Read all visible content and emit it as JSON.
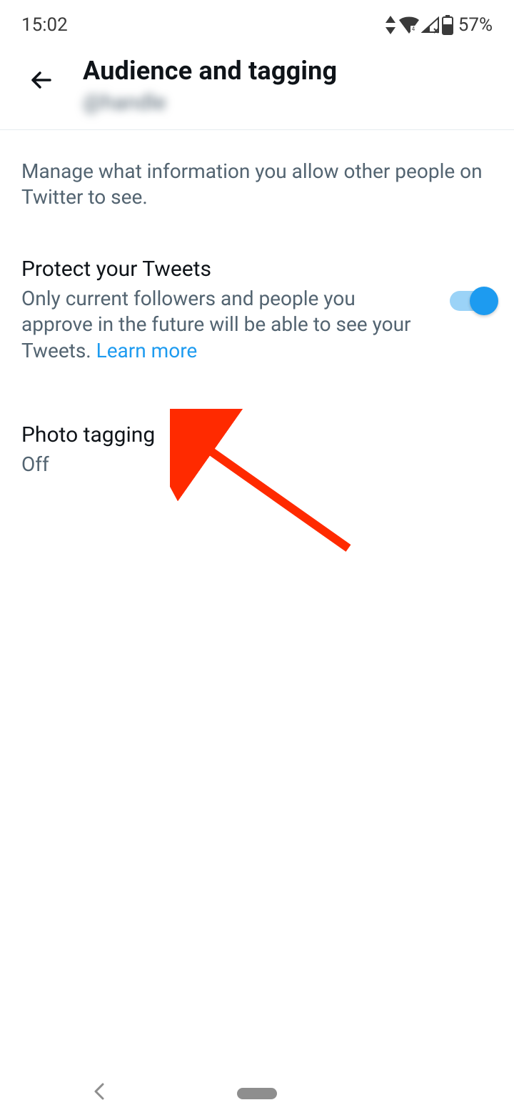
{
  "status_bar": {
    "time": "15:02",
    "battery_text": "57%"
  },
  "appbar": {
    "title": "Audience and tagging",
    "subtitle": "@handle"
  },
  "description": "Manage what information you allow other people on Twitter to see.",
  "protect": {
    "title": "Protect your Tweets",
    "desc_prefix": "Only current followers and people you approve in the future will be able to see your Tweets. ",
    "learn_more": "Learn more",
    "on": true
  },
  "photo_tagging": {
    "title": "Photo tagging",
    "value": "Off"
  }
}
